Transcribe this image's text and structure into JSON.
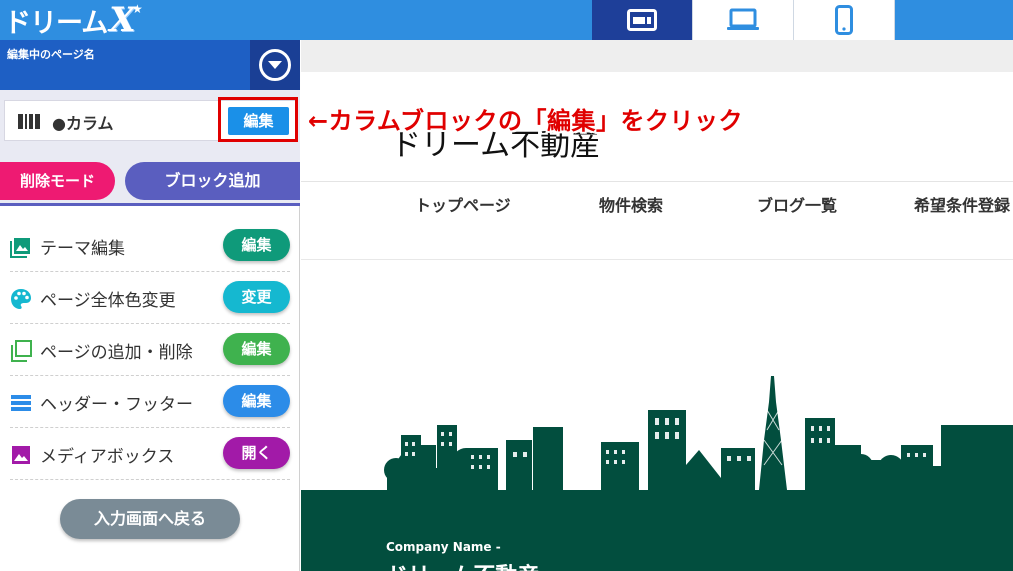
{
  "app": {
    "logo_text": "ドリーム",
    "logo_mark": "X"
  },
  "device_tabs": [
    {
      "icon": "tablet-landscape-icon",
      "active": true
    },
    {
      "icon": "laptop-icon",
      "active": false
    },
    {
      "icon": "smartphone-icon",
      "active": false
    }
  ],
  "sidebar": {
    "page_name_label": "編集中のページ名",
    "block": {
      "name": "●カラム",
      "edit_label": "編集"
    },
    "delete_mode_label": "削除モード",
    "add_block_label": "ブロック追加",
    "menu": [
      {
        "icon": "image-icon",
        "label": "テーマ編集",
        "button": "編集",
        "color": "#0f9a7a"
      },
      {
        "icon": "palette-icon",
        "label": "ページ全体色変更",
        "button": "変更",
        "color": "#15b8d0"
      },
      {
        "icon": "pages-icon",
        "label": "ページの追加・削除",
        "button": "編集",
        "color": "#3fb24e"
      },
      {
        "icon": "header-footer-icon",
        "label": "ヘッダー・フッター",
        "button": "編集",
        "color": "#2c8ce8"
      },
      {
        "icon": "media-icon",
        "label": "メディアボックス",
        "button": "開く",
        "color": "#a21aa8"
      }
    ],
    "back_label": "入力画面へ戻る"
  },
  "preview": {
    "site_title": "ドリーム不動産",
    "nav": [
      "トップページ",
      "物件検索",
      "ブログ一覧",
      "希望条件登録"
    ],
    "company_name": "Company Name -",
    "company_title": "ドリーム不動産"
  },
  "annotation": {
    "text": "←カラムブロックの「編集」をクリック",
    "color": "#e00000"
  }
}
